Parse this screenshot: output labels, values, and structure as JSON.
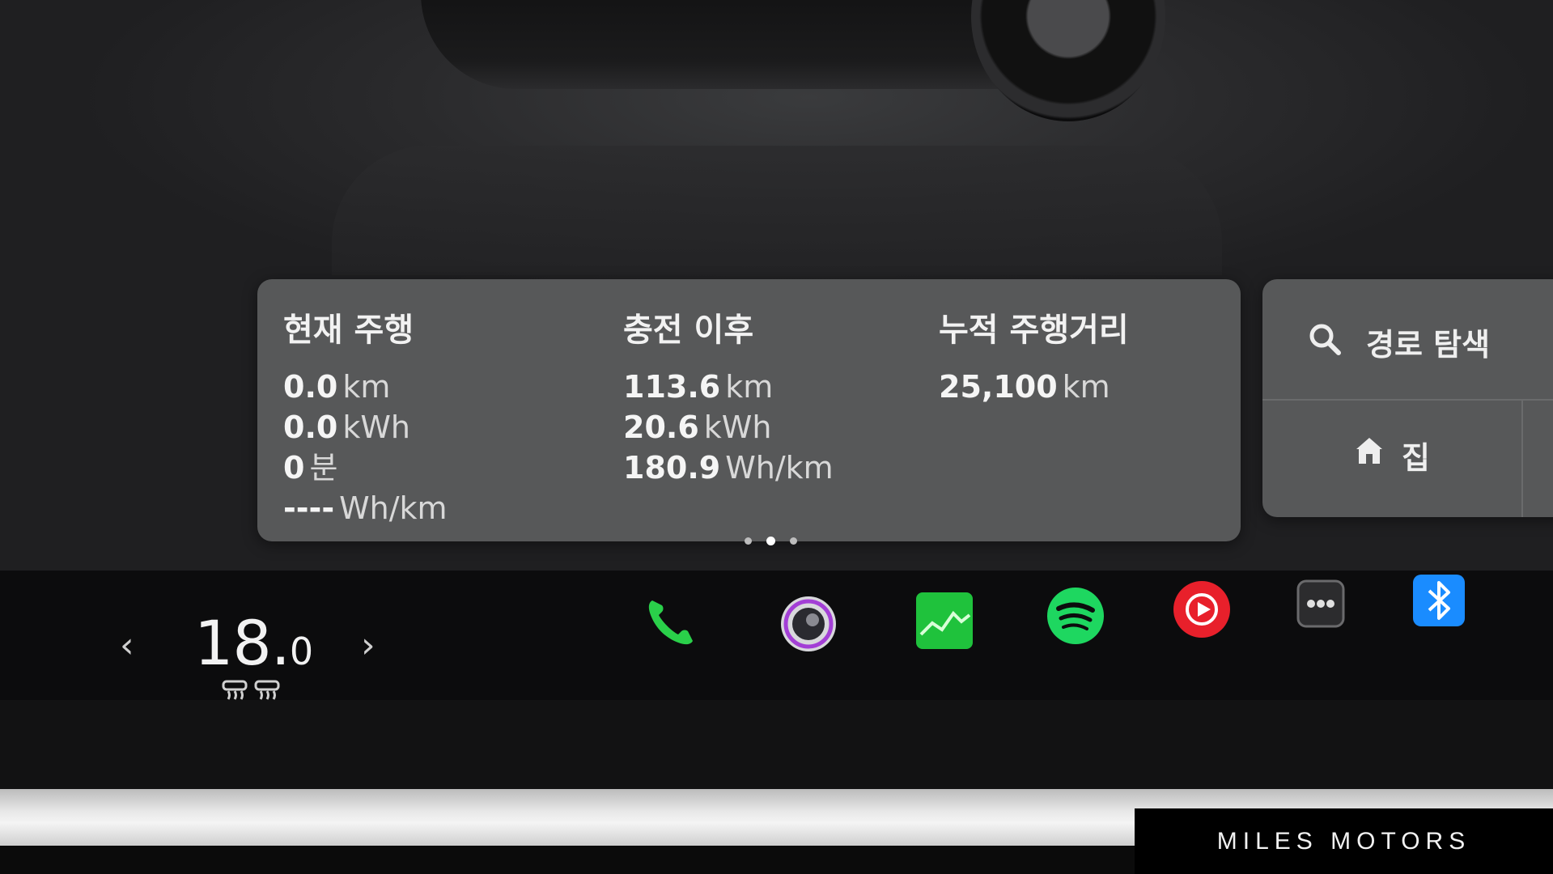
{
  "trip_card": {
    "current_drive": {
      "heading": "현재 주행",
      "rows": [
        {
          "value": "0.0",
          "unit": "km"
        },
        {
          "value": "0.0",
          "unit": "kWh"
        },
        {
          "value": "0",
          "unit": "분"
        },
        {
          "value": "----",
          "unit": "Wh/km"
        }
      ]
    },
    "since_charge": {
      "heading": "충전 이후",
      "rows": [
        {
          "value": "113.6",
          "unit": "km"
        },
        {
          "value": "20.6",
          "unit": "kWh"
        },
        {
          "value": "180.9",
          "unit": "Wh/km"
        }
      ]
    },
    "odometer": {
      "heading": "누적 주행거리",
      "rows": [
        {
          "value": "25,100",
          "unit": "km"
        }
      ]
    },
    "page_dots": {
      "count": 3,
      "active_index": 1
    }
  },
  "navigation": {
    "search_label": "경로 탐색",
    "search_icon": "search-icon",
    "home_label": "집",
    "home_icon": "home-icon"
  },
  "climate": {
    "temp_whole": "18.",
    "temp_decimal": "0",
    "left_arrow": "‹",
    "right_arrow": "›",
    "icons": [
      "seat-heater-left-icon",
      "seat-heater-right-icon"
    ]
  },
  "dock": {
    "apps": [
      {
        "name": "phone-icon",
        "color": "#2ad04a"
      },
      {
        "name": "camera-icon",
        "color": "#9b3fd0"
      },
      {
        "name": "energy-chart-icon",
        "color": "#1fc23c"
      },
      {
        "name": "spotify-icon",
        "color": "#1ed760"
      },
      {
        "name": "media-player-icon",
        "color": "#e8202b"
      },
      {
        "name": "more-apps-icon",
        "color": "#3a3a3c"
      },
      {
        "name": "bluetooth-icon",
        "color": "#1a8cff"
      }
    ]
  },
  "watermark": {
    "text": "MILES MOTORS"
  }
}
